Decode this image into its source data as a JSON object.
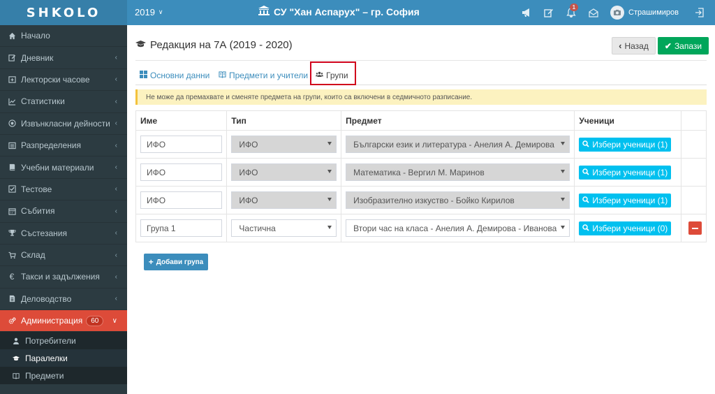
{
  "topbar": {
    "logo": "SHKOLO",
    "year": "2019",
    "school": "СУ \"Хан Аспарух\" – гр. София",
    "notifications_count": "1",
    "user_name": "Страшимиров"
  },
  "sidebar": {
    "items": [
      {
        "label": "Начало",
        "icon": "home-icon"
      },
      {
        "label": "Дневник",
        "icon": "edit-icon"
      },
      {
        "label": "Лекторски часове",
        "icon": "calendar-plus-icon"
      },
      {
        "label": "Статистики",
        "icon": "line-chart-icon"
      },
      {
        "label": "Извънкласни дейности",
        "icon": "soccer-ball-icon"
      },
      {
        "label": "Разпределения",
        "icon": "list-alt-icon"
      },
      {
        "label": "Учебни материали",
        "icon": "book-icon"
      },
      {
        "label": "Тестове",
        "icon": "check-square-icon"
      },
      {
        "label": "Събития",
        "icon": "calendar-icon"
      },
      {
        "label": "Състезания",
        "icon": "trophy-icon"
      },
      {
        "label": "Склад",
        "icon": "cart-icon"
      },
      {
        "label": "Такси и задължения",
        "icon": "euro-icon"
      },
      {
        "label": "Деловодство",
        "icon": "file-icon"
      },
      {
        "label": "Администрация",
        "icon": "cogs-icon",
        "badge": "60"
      }
    ],
    "submenu": [
      {
        "label": "Потребители",
        "icon": "user-icon"
      },
      {
        "label": "Паралелки",
        "icon": "graduation-cap-icon"
      },
      {
        "label": "Предмети",
        "icon": "book-open-icon"
      }
    ]
  },
  "page": {
    "title": "Редакция на 7А (2019 - 2020)",
    "back_label": "Назад",
    "save_label": "Запази",
    "tabs": [
      {
        "label": "Основни данни"
      },
      {
        "label": "Предмети и учители"
      },
      {
        "label": "Групи"
      }
    ],
    "notice": "Не може да премахвате и сменяте предмета на групи, които са включени в седмичното разписание.",
    "add_group_label": "Добави група"
  },
  "table": {
    "headers": [
      "Име",
      "Тип",
      "Предмет",
      "Ученици",
      ""
    ],
    "rows": [
      {
        "name": "ИФО",
        "type": "ИФО",
        "subject": "Български език и литература - Анелия А. Демирова",
        "students": "Избери ученици (1)"
      },
      {
        "name": "ИФО",
        "type": "ИФО",
        "subject": "Математика - Вергил М. Маринов",
        "students": "Избери ученици (1)"
      },
      {
        "name": "ИФО",
        "type": "ИФО",
        "subject": "Изобразително изкуство - Бойко Кирилов",
        "students": "Избери ученици (1)"
      },
      {
        "name": "Група 1",
        "type": "Частична",
        "subject": "Втори час на класа - Анелия А. Демирова - Иванова",
        "students": "Избери ученици (0)"
      }
    ]
  },
  "colors": {
    "topbar": "#3c8dbc",
    "sidebar": "#2c3b41",
    "active_menu": "#dd4b39",
    "save_button": "#00a65a",
    "pick_button": "#00c0ef",
    "notice_bg": "#fcf2c0",
    "highlight": "#d0021b"
  }
}
